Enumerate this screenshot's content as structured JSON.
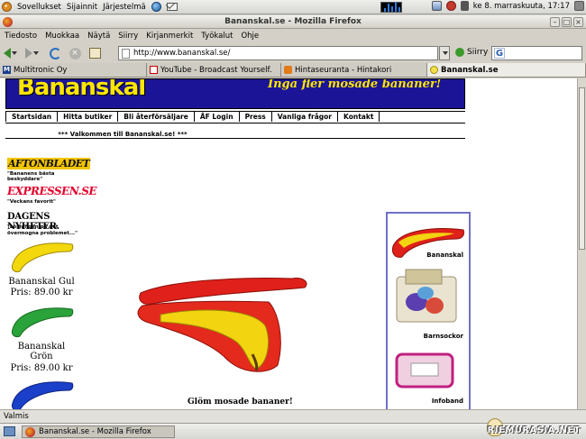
{
  "top_panel": {
    "menus": [
      "Sovellukset",
      "Sijainnit",
      "Järjestelmä"
    ],
    "clock": "ke  8. marraskuuta, 17:17"
  },
  "window": {
    "title": "Bananskal.se - Mozilla Firefox",
    "minimize": "–",
    "maximize": "□",
    "close": "×"
  },
  "menubar": [
    "Tiedosto",
    "Muokkaa",
    "Näytä",
    "Siirry",
    "Kirjanmerkit",
    "Työkalut",
    "Ohje"
  ],
  "navbar": {
    "url": "http://www.bananskal.se/",
    "go_label": "Siirry",
    "search_value": ""
  },
  "tabs": [
    {
      "label": "Multitronic Oy",
      "icon": "m-icon"
    },
    {
      "label": "YouTube - Broadcast Yourself.",
      "icon": "youtube-icon"
    },
    {
      "label": "Hintaseuranta - Hintakori",
      "icon": "hintakori-icon"
    },
    {
      "label": "Bananskal.se",
      "icon": "banana-icon",
      "active": true
    }
  ],
  "site": {
    "logo": "Bananskal",
    "slogan": "Inga fler mosade bananer!",
    "nav": [
      "Startsidan",
      "Hitta butiker",
      "Bli återförsäljare",
      "ÅF Login",
      "Press",
      "Vanliga frågor",
      "Kontakt"
    ],
    "welcome": "***     Valkommen till Bananskal.se!     ***",
    "press": [
      {
        "logo": "AFTONBLADET",
        "quote": "\"Bananens bästa beskyddare\""
      },
      {
        "logo": "EXPRESSEN.SE",
        "quote": "\"Veckans favorit\""
      },
      {
        "logo": "DAGENS NYHETER.",
        "quote": "\"Lösningen på det övermogna problemet...\""
      }
    ],
    "products": [
      {
        "name": "Bananskal Gul",
        "price": "Pris: 89.00 kr",
        "color": "#f2d80c"
      },
      {
        "name": "Bananskal Grön",
        "price": "Pris: 89.00 kr",
        "color": "#2aa33a"
      },
      {
        "name": "",
        "price": "",
        "color": "#1a3fc8"
      }
    ],
    "hero_caption": "Glöm mosade bananer!",
    "side_items": [
      "Bananskal",
      "Barnsockor",
      "Infoband"
    ],
    "colors": {
      "banner": "#1b1497",
      "logo": "#ffe600",
      "case": "#e0201a",
      "banana": "#f2d410"
    }
  },
  "statusbar": "Valmis",
  "taskbar": {
    "item": "Bananskal.se - Mozilla Firefox",
    "watermark": "RIEMURASIA.NET"
  }
}
